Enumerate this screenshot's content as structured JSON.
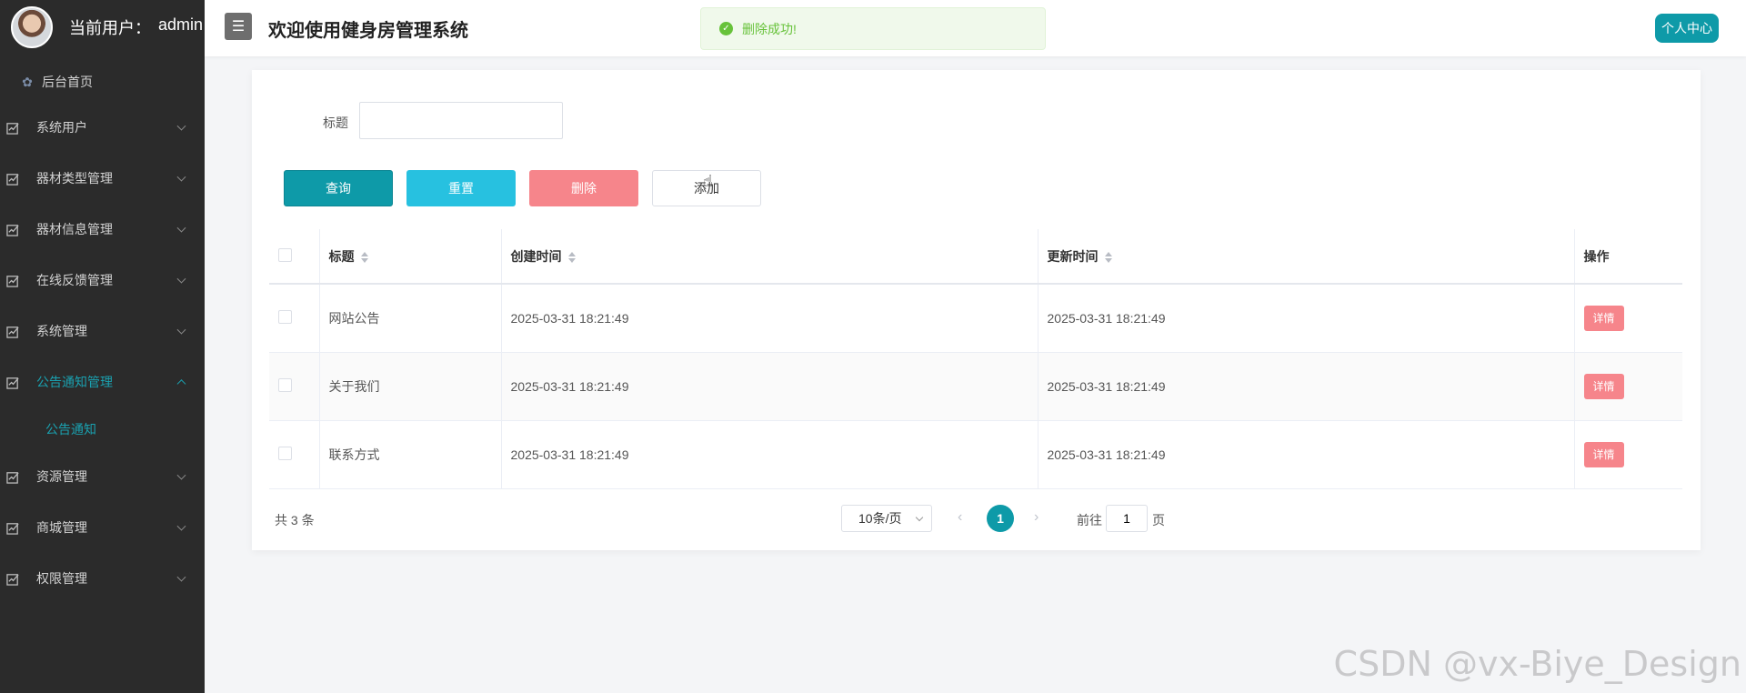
{
  "sidebar": {
    "user_label": "当前用户：",
    "username": "admin",
    "home": "后台首页",
    "items": [
      {
        "label": "系统用户"
      },
      {
        "label": "器材类型管理"
      },
      {
        "label": "器材信息管理"
      },
      {
        "label": "在线反馈管理"
      },
      {
        "label": "系统管理"
      },
      {
        "label": "公告通知管理"
      },
      {
        "label": "资源管理"
      },
      {
        "label": "商城管理"
      },
      {
        "label": "权限管理"
      }
    ],
    "sub_item": "公告通知"
  },
  "header": {
    "menu_toggle": "☰",
    "title": "欢迎使用健身房管理系统",
    "profile": "个人中心",
    "toast": "删除成功!"
  },
  "search": {
    "label": "标题",
    "value": ""
  },
  "buttons": {
    "query": "查询",
    "reset": "重置",
    "delete": "删除",
    "add": "添加"
  },
  "table": {
    "columns": {
      "title": "标题",
      "created": "创建时间",
      "updated": "更新时间",
      "ops": "操作"
    },
    "rows": [
      {
        "title": "网站公告",
        "created": "2025-03-31 18:21:49",
        "updated": "2025-03-31 18:21:49",
        "action": "详情"
      },
      {
        "title": "关于我们",
        "created": "2025-03-31 18:21:49",
        "updated": "2025-03-31 18:21:49",
        "action": "详情"
      },
      {
        "title": "联系方式",
        "created": "2025-03-31 18:21:49",
        "updated": "2025-03-31 18:21:49",
        "action": "详情"
      }
    ]
  },
  "pagination": {
    "total": "共 3 条",
    "page_size": "10条/页",
    "current": "1",
    "goto_label": "前往",
    "goto_value": "1",
    "page_suffix": "页"
  },
  "watermark": "CSDN @vx-Biye_Design",
  "colors": {
    "sidebar_bg": "#2b2b2b",
    "accent": "#0e9aa8",
    "danger": "#f6858b",
    "info": "#27c1e0",
    "success": "#67c23a"
  }
}
